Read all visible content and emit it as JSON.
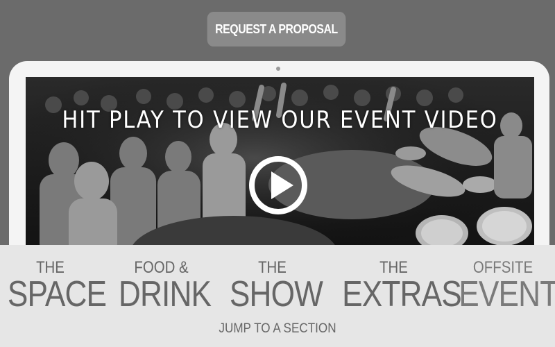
{
  "header": {
    "proposal_button_label": "REQUEST A PROPOSAL"
  },
  "video": {
    "title": "HIT PLAY TO VIEW OUR EVENT VIDEO",
    "play_icon": "play-icon"
  },
  "sections": {
    "items": [
      {
        "small": "THE",
        "big": "SPACE"
      },
      {
        "small": "FOOD &",
        "big": "DRINK"
      },
      {
        "small": "THE",
        "big": "SHOW"
      },
      {
        "small": "THE",
        "big": "EXTRAS"
      },
      {
        "small": "OFFSITE",
        "big": "EVENTS"
      }
    ],
    "jump_label": "JUMP TO A SECTION"
  },
  "colors": {
    "page_background": "#6b6b6b",
    "button_background": "#8a8a8a",
    "nav_background": "#e6e6e6",
    "nav_text": "#666666",
    "laptop_bezel": "#f4f4f4"
  }
}
